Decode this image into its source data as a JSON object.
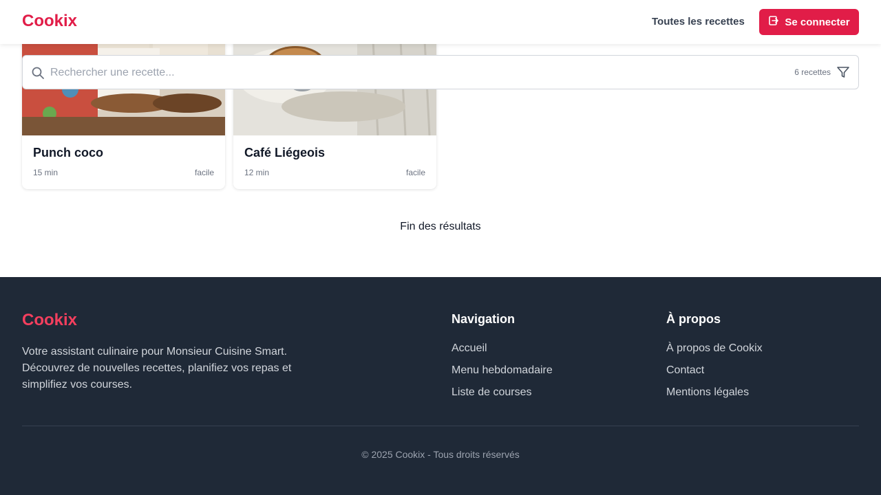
{
  "header": {
    "logo": "Cookix",
    "nav_all_recipes": "Toutes les recettes",
    "login_label": "Se connecter"
  },
  "search": {
    "placeholder": "Rechercher une recette...",
    "count": "6 recettes"
  },
  "recipes": [
    {
      "title": "Punch coco",
      "time": "15 min",
      "difficulty": "facile"
    },
    {
      "title": "Café Liégeois",
      "time": "12 min",
      "difficulty": "facile"
    }
  ],
  "end_text": "Fin des résultats",
  "footer": {
    "logo": "Cookix",
    "description": "Votre assistant culinaire pour Monsieur Cuisine Smart. Découvrez de nouvelles recettes, planifiez vos repas et simplifiez vos courses.",
    "navigation": {
      "title": "Navigation",
      "links": [
        "Accueil",
        "Menu hebdomadaire",
        "Liste de courses"
      ]
    },
    "about": {
      "title": "À propos",
      "links": [
        "À propos de Cookix",
        "Contact",
        "Mentions légales"
      ]
    },
    "copyright": "© 2025 Cookix - Tous droits réservés"
  },
  "colors": {
    "brand": "#e11d48",
    "footer_bg": "#1f2937"
  }
}
